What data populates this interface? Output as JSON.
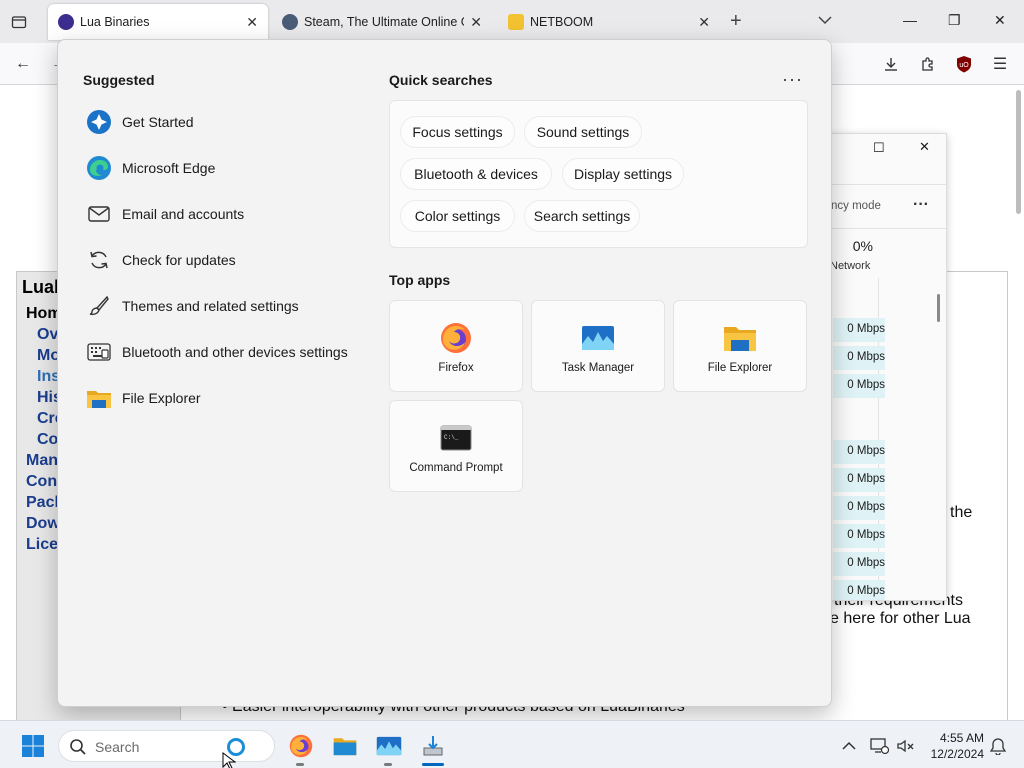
{
  "browser": {
    "tabs": [
      {
        "title": "Lua Binaries",
        "active": true
      },
      {
        "title": "Steam, The Ultimate Online Ga",
        "active": false
      },
      {
        "title": "NETBOOM",
        "active": false
      }
    ]
  },
  "background_page": {
    "sidebar_title": "Luab",
    "nav": [
      "Hom",
      "Ov",
      "Mo",
      "Ins",
      "His",
      "Cre",
      "Co",
      "Man",
      "Cont",
      "Pack",
      "Dow",
      "Lice"
    ],
    "text_fragments": [
      "the",
      "their requirements",
      "e here for other Lua",
      "Easier interoperability with other products based on LuaBinaries"
    ]
  },
  "task_manager": {
    "header": "ncy mode",
    "network_percent": "0%",
    "network_label": "Network",
    "rows": [
      "0 Mbps",
      "0 Mbps",
      "0 Mbps",
      "0 Mbps",
      "0 Mbps",
      "0 Mbps",
      "0 Mbps",
      "0 Mbps",
      "0 Mbps"
    ]
  },
  "start_menu": {
    "suggested_title": "Suggested",
    "suggested": [
      {
        "label": "Get Started",
        "icon": "get-started-icon"
      },
      {
        "label": "Microsoft Edge",
        "icon": "edge-icon"
      },
      {
        "label": "Email and accounts",
        "icon": "mail-icon"
      },
      {
        "label": "Check for updates",
        "icon": "refresh-icon"
      },
      {
        "label": "Themes and related settings",
        "icon": "brush-icon"
      },
      {
        "label": "Bluetooth and other devices settings",
        "icon": "keyboard-icon"
      },
      {
        "label": "File Explorer",
        "icon": "folder-icon"
      }
    ],
    "quick_searches_title": "Quick searches",
    "quick_searches": [
      "Focus settings",
      "Sound settings",
      "Bluetooth & devices",
      "Display settings",
      "Color settings",
      "Search settings"
    ],
    "top_apps_title": "Top apps",
    "top_apps": [
      {
        "label": "Firefox",
        "icon": "firefox-icon"
      },
      {
        "label": "Task Manager",
        "icon": "task-manager-icon"
      },
      {
        "label": "File Explorer",
        "icon": "file-explorer-icon"
      },
      {
        "label": "Command Prompt",
        "icon": "command-prompt-icon"
      }
    ]
  },
  "taskbar": {
    "search_placeholder": "Search",
    "time": "4:55 AM",
    "date": "12/2/2024"
  },
  "colors": {
    "accent": "#0067c0",
    "firefox": "#ff7139",
    "folder": "#f7c542"
  }
}
